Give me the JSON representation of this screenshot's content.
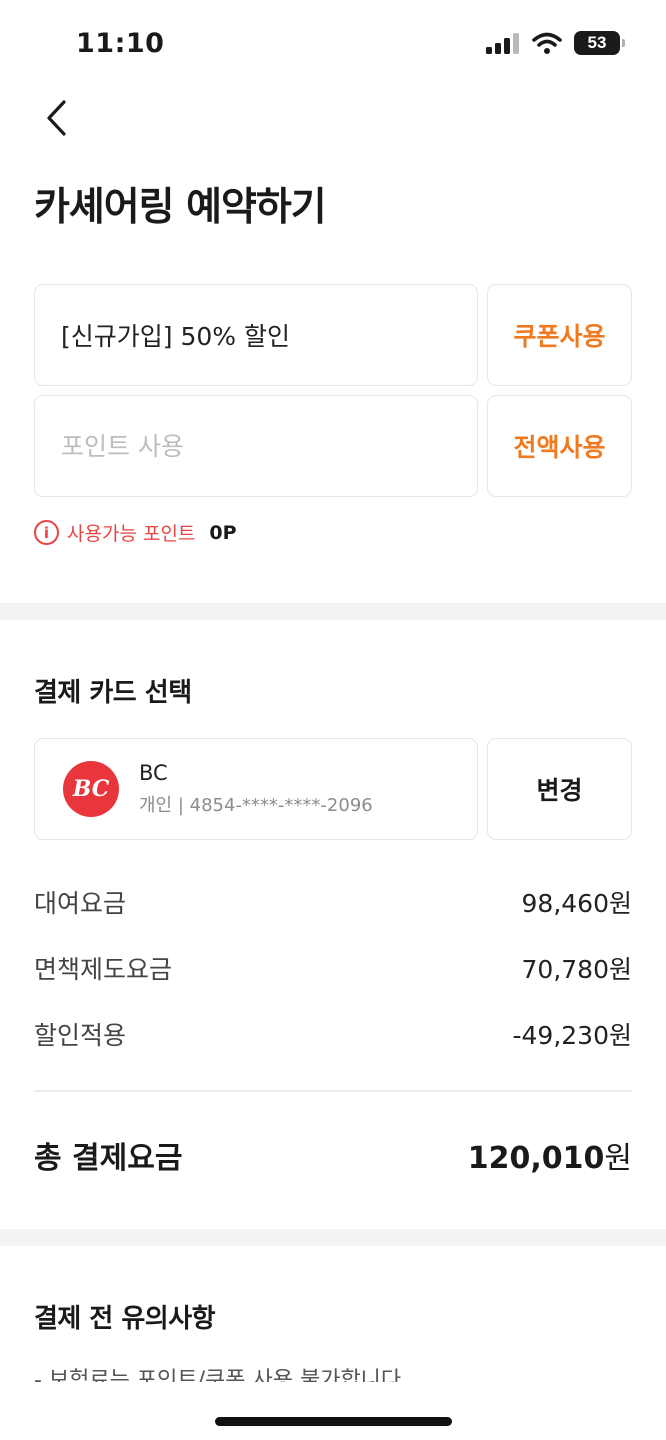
{
  "status_bar": {
    "time": "11:10",
    "battery": "53",
    "icons": [
      "signal-icon",
      "wifi-icon",
      "battery-icon"
    ]
  },
  "header": {
    "back_icon": "chevron-left-icon",
    "title": "카셰어링 예약하기"
  },
  "coupon": {
    "value": "[신규가입] 50% 할인",
    "button_label": "쿠폰사용"
  },
  "points": {
    "placeholder": "포인트 사용",
    "button_label": "전액사용",
    "available_label": "사용가능 포인트",
    "available_value": "0P"
  },
  "payment_card": {
    "section_title": "결제 카드 선택",
    "logo_text": "BC",
    "card_name": "BC",
    "card_detail": "개인 | 4854-****-****-2096",
    "change_label": "변경"
  },
  "fees": [
    {
      "label": "대여요금",
      "amount": "98,460원"
    },
    {
      "label": "면책제도요금",
      "amount": "70,780원"
    },
    {
      "label": "할인적용",
      "amount": "-49,230원"
    }
  ],
  "total": {
    "label": "총 결제요금",
    "amount_number": "120,010",
    "amount_unit": "원"
  },
  "notes": {
    "section_title": "결제 전 유의사항",
    "first_line": "- 보험료는 포인트/쿠폰 사용 불가합니다"
  },
  "colors": {
    "accent": "#f07a20",
    "warning": "#e84545",
    "bc_brand": "#e8363c",
    "divider": "#f3f3f3"
  }
}
